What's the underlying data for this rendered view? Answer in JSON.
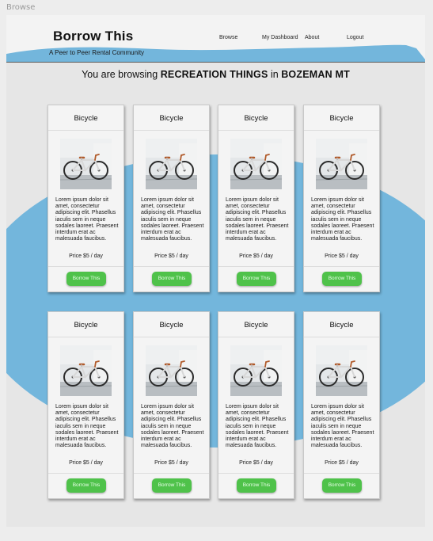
{
  "frame": {
    "label": "Browse"
  },
  "header": {
    "brand": "Borrow This",
    "tagline": "A Peer to Peer Rental Community",
    "nav": [
      {
        "label": "Browse"
      },
      {
        "label": "My Dashboard"
      },
      {
        "label": "About"
      },
      {
        "label": "Logout"
      }
    ]
  },
  "browse": {
    "prefix": "You are browsing",
    "category": "RECREATION THINGS",
    "joiner": "in",
    "location": "BOZEMAN MT"
  },
  "listings": [
    {
      "title": "Bicycle",
      "image_icon": "bicycle-photo",
      "description": "Lorem ipsum dolor sit amet, consectetur adipiscing elit. Phasellus iaculis sem in neque sodales laoreet. Praesent interdum erat ac malesuada faucibus.",
      "price": "Price $5 / day",
      "button": "Borrow This"
    },
    {
      "title": "Bicycle",
      "image_icon": "bicycle-photo",
      "description": "Lorem ipsum dolor sit amet, consectetur adipiscing elit. Phasellus iaculis sem in neque sodales laoreet. Praesent interdum erat ac malesuada faucibus.",
      "price": "Price $5 / day",
      "button": "Borrow This"
    },
    {
      "title": "Bicycle",
      "image_icon": "bicycle-photo",
      "description": "Lorem ipsum dolor sit amet, consectetur adipiscing elit. Phasellus iaculis sem in neque sodales laoreet. Praesent interdum erat ac malesuada faucibus.",
      "price": "Price $5 / day",
      "button": "Borrow This"
    },
    {
      "title": "Bicycle",
      "image_icon": "bicycle-photo",
      "description": "Lorem ipsum dolor sit amet, consectetur adipiscing elit. Phasellus iaculis sem in neque sodales laoreet. Praesent interdum erat ac malesuada faucibus.",
      "price": "Price $5 / day",
      "button": "Borrow This"
    },
    {
      "title": "Bicycle",
      "image_icon": "bicycle-photo",
      "description": "Lorem ipsum dolor sit amet, consectetur adipiscing elit. Phasellus iaculis sem in neque sodales laoreet. Praesent interdum erat ac malesuada faucibus.",
      "price": "Price $5 / day",
      "button": "Borrow This"
    },
    {
      "title": "Bicycle",
      "image_icon": "bicycle-photo",
      "description": "Lorem ipsum dolor sit amet, consectetur adipiscing elit. Phasellus iaculis sem in neque sodales laoreet. Praesent interdum erat ac malesuada faucibus.",
      "price": "Price $5 / day",
      "button": "Borrow This"
    },
    {
      "title": "Bicycle",
      "image_icon": "bicycle-photo",
      "description": "Lorem ipsum dolor sit amet, consectetur adipiscing elit. Phasellus iaculis sem in neque sodales laoreet. Praesent interdum erat ac malesuada faucibus.",
      "price": "Price $5 / day",
      "button": "Borrow This"
    },
    {
      "title": "Bicycle",
      "image_icon": "bicycle-photo",
      "description": "Lorem ipsum dolor sit amet, consectetur adipiscing elit. Phasellus iaculis sem in neque sodales laoreet. Praesent interdum erat ac malesuada faucibus.",
      "price": "Price $5 / day",
      "button": "Borrow This"
    }
  ],
  "colors": {
    "accent_blue": "#73b6dc",
    "button_green": "#4fc24a",
    "card_bg": "#f4f4f4",
    "page_bg": "#e6e6e6"
  }
}
